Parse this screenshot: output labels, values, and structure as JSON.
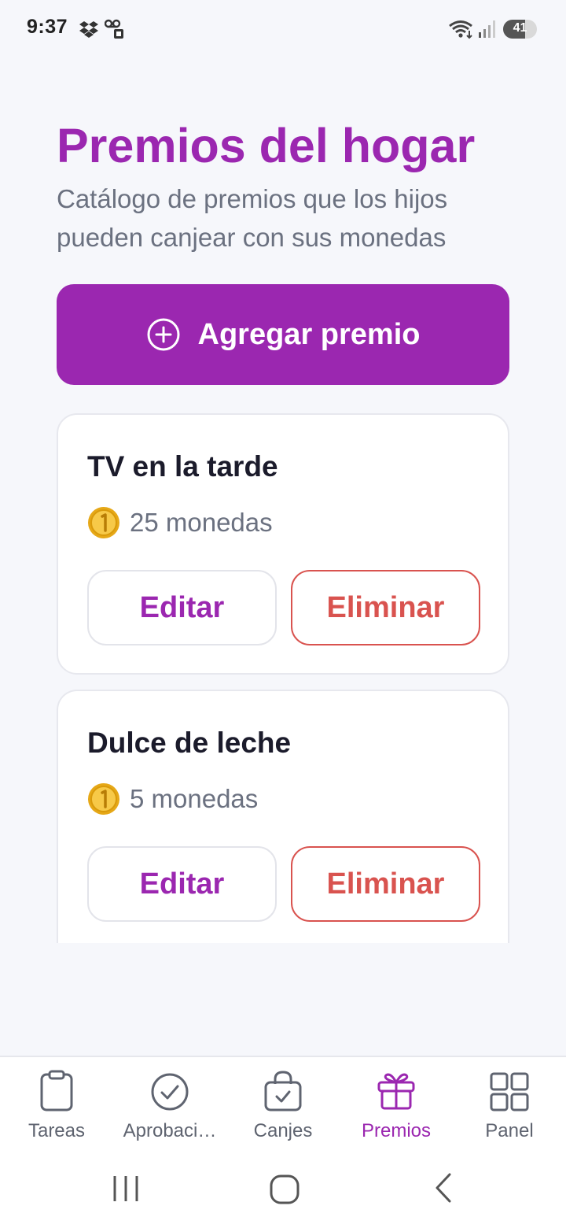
{
  "status_bar": {
    "time": "9:37",
    "battery_level": "41",
    "icons": [
      "dropbox-icon",
      "voicemail-icon",
      "wifi-icon",
      "signal-icon",
      "battery-icon"
    ]
  },
  "header": {
    "title": "Premios del hogar",
    "subtitle": "Catálogo de premios que los hijos pueden canjear con sus monedas"
  },
  "add_button": {
    "label": "Agregar premio",
    "icon": "plus-circle-icon"
  },
  "rewards": [
    {
      "name": "TV en la tarde",
      "cost": "25 monedas",
      "edit_label": "Editar",
      "delete_label": "Eliminar"
    },
    {
      "name": "Dulce de leche",
      "cost": "5 monedas",
      "edit_label": "Editar",
      "delete_label": "Eliminar"
    }
  ],
  "coin_icon": "🪙",
  "bottom_nav": {
    "items": [
      {
        "label": "Tareas",
        "icon": "clipboard-icon"
      },
      {
        "label": "Aprobaci…",
        "icon": "check-circle-icon"
      },
      {
        "label": "Canjes",
        "icon": "shopping-bag-icon"
      },
      {
        "label": "Premios",
        "icon": "gift-icon",
        "active": true
      },
      {
        "label": "Panel",
        "icon": "grid-icon"
      }
    ]
  },
  "colors": {
    "primary": "#9b27b0",
    "danger": "#d9534f",
    "background": "#f6f7fb",
    "muted_text": "#6b7180"
  }
}
